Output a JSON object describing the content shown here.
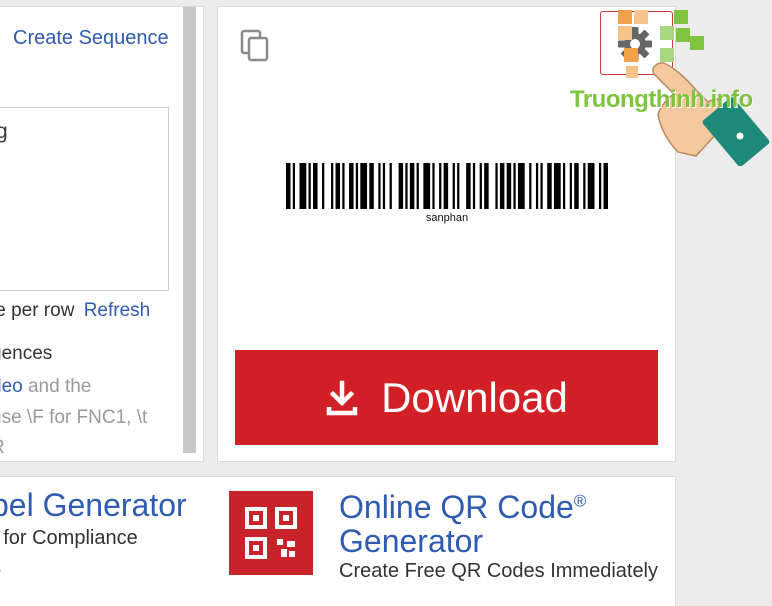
{
  "left_panel": {
    "create_sequence": "Create Sequence",
    "textarea_value": "g",
    "line_per_row": "le per row",
    "refresh": "Refresh",
    "sequences": "uences",
    "deo": "deo",
    "and_the": " and the",
    "use_fnc": "use \\F for FNC1, \\t",
    "r_char": "R"
  },
  "right_panel": {
    "barcode_text": "sanphan",
    "download_label": "Download",
    "copy_icon": "copy-icon",
    "settings_icon": "gear-icon",
    "download_color": "#d22027"
  },
  "bottom": {
    "label_gen_title": "bel Generator",
    "label_gen_sub": "r for Compliance",
    "label_gen_sub2": "s",
    "qr_title_line1": "Online QR Code",
    "qr_reg": "®",
    "qr_title_line2": "Generator",
    "qr_sub": "Create Free QR Codes Immediately"
  },
  "watermark": {
    "text": "Truongthinh.info"
  }
}
